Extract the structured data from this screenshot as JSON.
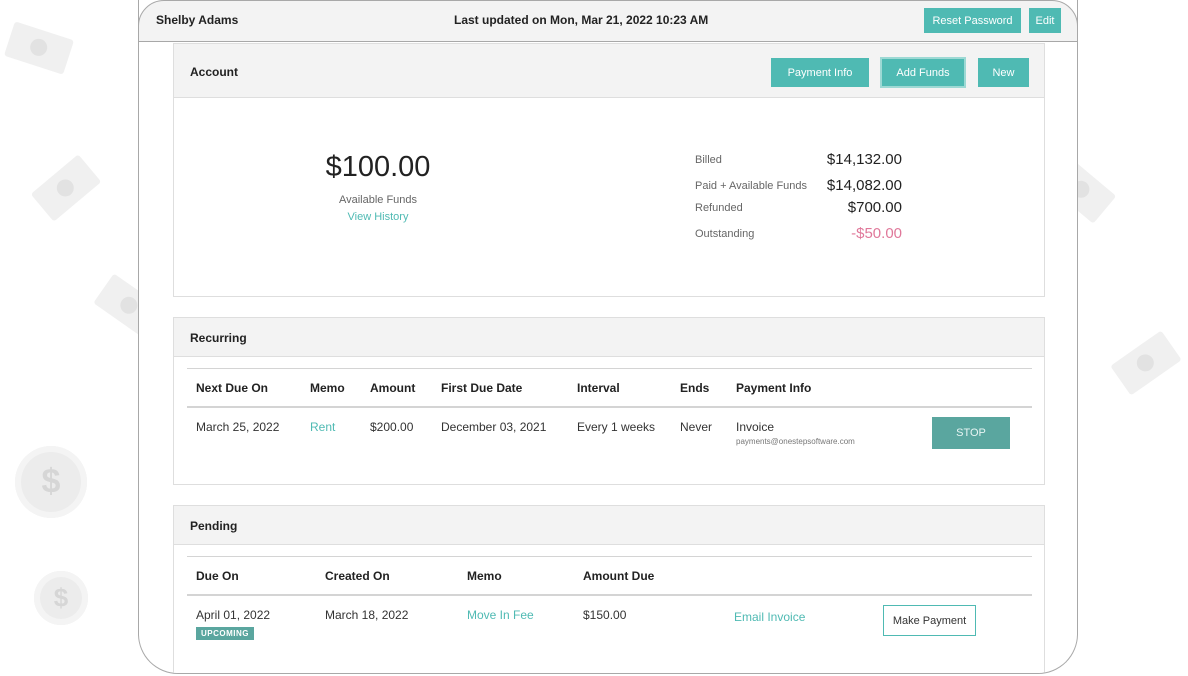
{
  "header": {
    "user_name": "Shelby Adams",
    "last_updated": "Last updated on Mon, Mar 21, 2022 10:23 AM",
    "reset_password_label": "Reset Password",
    "edit_label": "Edit"
  },
  "account": {
    "title": "Account",
    "payment_info_label": "Payment Info",
    "add_funds_label": "Add Funds",
    "new_label": "New",
    "available_amount": "$100.00",
    "available_label": "Available Funds",
    "view_history_label": "View History",
    "summary": [
      {
        "label": "Billed",
        "value": "$14,132.00"
      },
      {
        "label": "Paid + Available Funds",
        "value": "$14,082.00"
      },
      {
        "label": "Refunded",
        "value": "$700.00"
      },
      {
        "label": "Outstanding",
        "value": "-$50.00"
      }
    ]
  },
  "recurring": {
    "title": "Recurring",
    "columns": [
      "Next Due On",
      "Memo",
      "Amount",
      "First Due Date",
      "Interval",
      "Ends",
      "Payment Info"
    ],
    "rows": [
      {
        "next_due_on": "March 25, 2022",
        "memo": "Rent",
        "amount": "$200.00",
        "first_due_date": "December 03, 2021",
        "interval": "Every 1 weeks",
        "ends": "Never",
        "payment_method": "Invoice",
        "payment_email": "payments@onestepsoftware.com",
        "stop_label": "STOP"
      }
    ]
  },
  "pending": {
    "title": "Pending",
    "columns": [
      "Due On",
      "Created On",
      "Memo",
      "Amount Due"
    ],
    "rows": [
      {
        "due_on": "April 01, 2022",
        "status_badge": "UPCOMING",
        "created_on": "March 18, 2022",
        "memo": "Move In Fee",
        "amount_due": "$150.00",
        "email_invoice_label": "Email Invoice",
        "make_payment_label": "Make Payment"
      }
    ]
  },
  "colors": {
    "accent": "#4fbab3",
    "stop_button": "#5aa69f",
    "negative": "#e0789a"
  }
}
